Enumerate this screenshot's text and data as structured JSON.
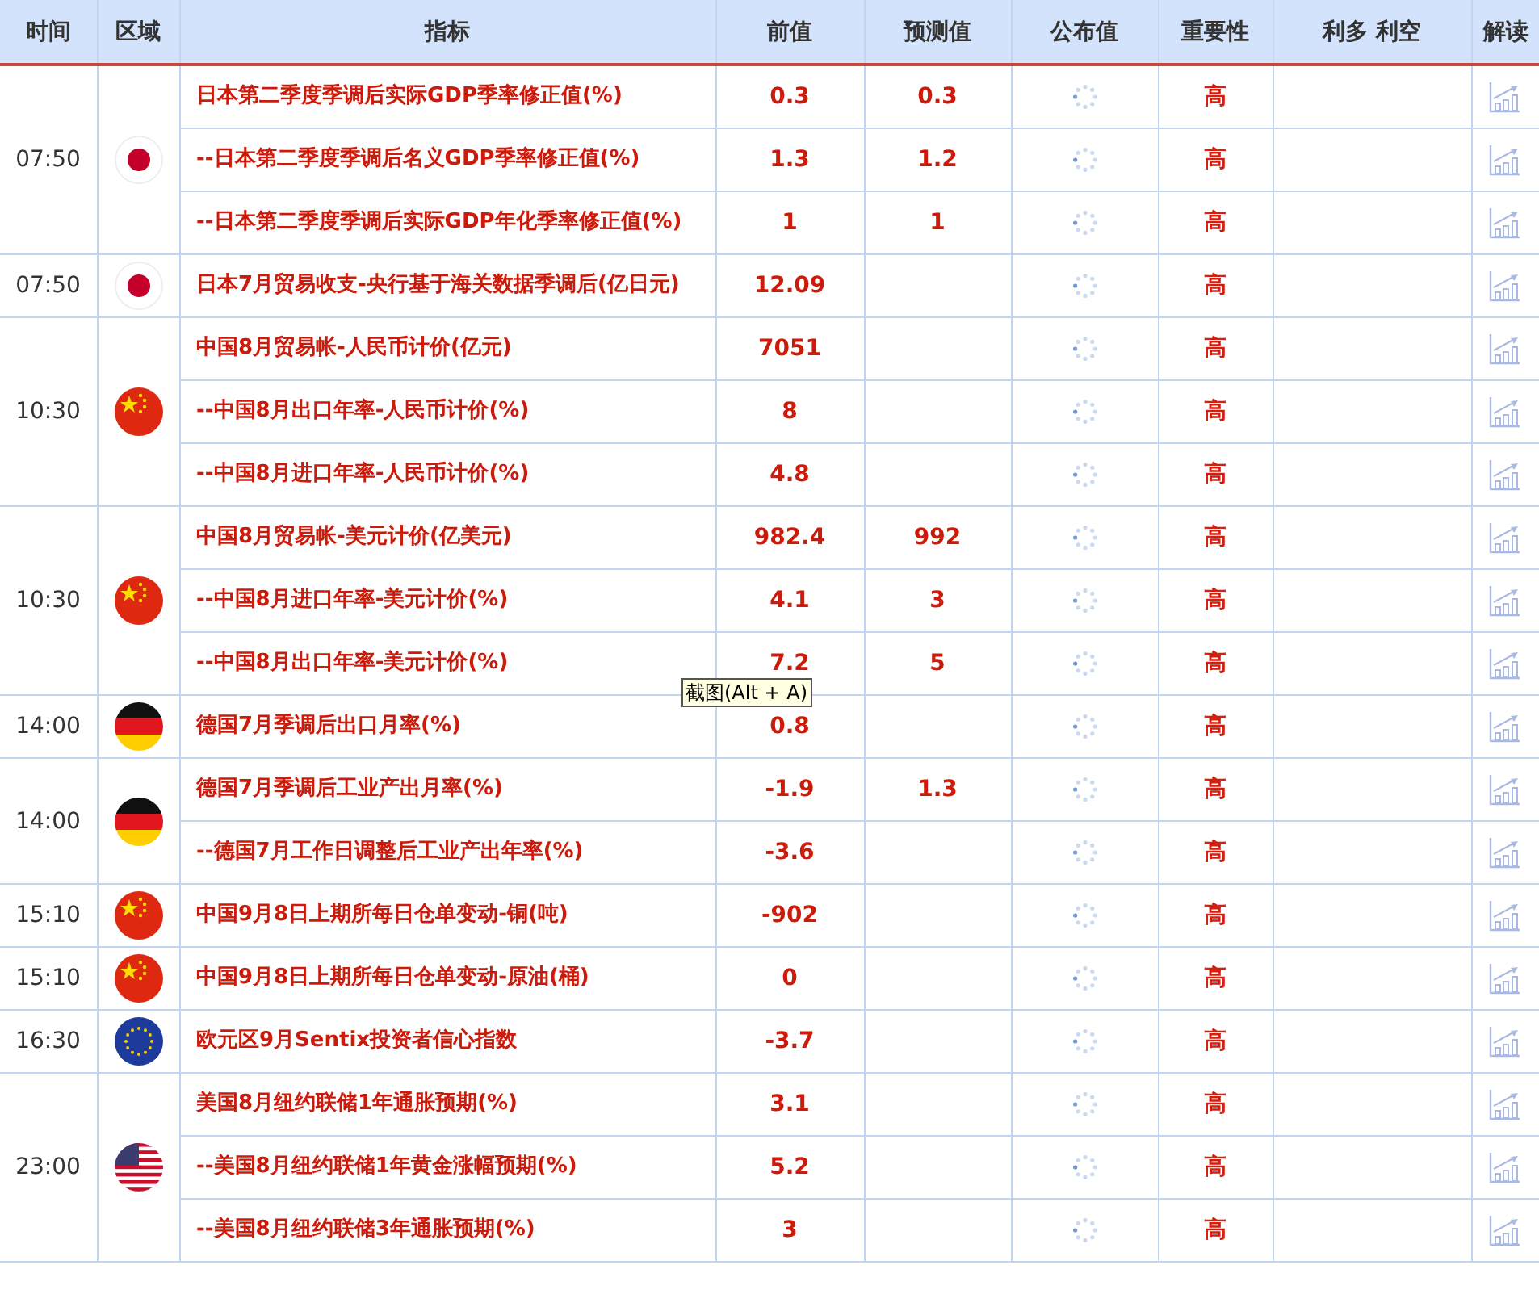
{
  "table": {
    "columns": [
      "时间",
      "区域",
      "指标",
      "前值",
      "预测值",
      "公布值",
      "重要性",
      "利多 利空",
      "解读"
    ],
    "groups": [
      {
        "time": "07:50",
        "kind": "jp",
        "rows": [
          {
            "indicator": "日本第二季度季调后实际GDP季率修正值(%)",
            "previous": "0.3",
            "forecast": "0.3",
            "importance": "高"
          },
          {
            "indicator": "--日本第二季度季调后名义GDP季率修正值(%)",
            "previous": "1.3",
            "forecast": "1.2",
            "importance": "高"
          },
          {
            "indicator": "--日本第二季度季调后实际GDP年化季率修正值(%)",
            "previous": "1",
            "forecast": "1",
            "importance": "高"
          }
        ]
      },
      {
        "time": "07:50",
        "kind": "jp",
        "rows": [
          {
            "indicator": "日本7月贸易收支-央行基于海关数据季调后(亿日元)",
            "previous": "12.09",
            "importance": "高"
          }
        ]
      },
      {
        "time": "10:30",
        "kind": "cn",
        "rows": [
          {
            "indicator": "中国8月贸易帐-人民币计价(亿元)",
            "previous": "7051",
            "importance": "高"
          },
          {
            "indicator": "--中国8月出口年率-人民币计价(%)",
            "previous": "8",
            "importance": "高"
          },
          {
            "indicator": "--中国8月进口年率-人民币计价(%)",
            "previous": "4.8",
            "importance": "高"
          }
        ]
      },
      {
        "time": "10:30",
        "kind": "cn",
        "rows": [
          {
            "indicator": "中国8月贸易帐-美元计价(亿美元)",
            "previous": "982.4",
            "forecast": "992",
            "importance": "高"
          },
          {
            "indicator": "--中国8月进口年率-美元计价(%)",
            "previous": "4.1",
            "forecast": "3",
            "importance": "高"
          },
          {
            "indicator": "--中国8月出口年率-美元计价(%)",
            "previous": "7.2",
            "forecast": "5",
            "importance": "高",
            "tooltip": "截图(Alt + A)"
          }
        ]
      },
      {
        "time": "14:00",
        "kind": "de",
        "rows": [
          {
            "indicator": "德国7月季调后出口月率(%)",
            "previous": "0.8",
            "importance": "高"
          }
        ]
      },
      {
        "time": "14:00",
        "kind": "de",
        "rows": [
          {
            "indicator": "德国7月季调后工业产出月率(%)",
            "previous": "-1.9",
            "forecast": "1.3",
            "importance": "高"
          },
          {
            "indicator": "--德国7月工作日调整后工业产出年率(%)",
            "previous": "-3.6",
            "importance": "高"
          }
        ]
      },
      {
        "time": "15:10",
        "kind": "cn",
        "rows": [
          {
            "indicator": "中国9月8日上期所每日仓单变动-铜(吨)",
            "previous": "-902",
            "importance": "高"
          }
        ]
      },
      {
        "time": "15:10",
        "kind": "cn",
        "rows": [
          {
            "indicator": "中国9月8日上期所每日仓单变动-原油(桶)",
            "previous": "0",
            "importance": "高"
          }
        ]
      },
      {
        "time": "16:30",
        "kind": "eu",
        "rows": [
          {
            "indicator": "欧元区9月Sentix投资者信心指数",
            "previous": "-3.7",
            "importance": "高"
          }
        ]
      },
      {
        "time": "23:00",
        "kind": "us",
        "rows": [
          {
            "indicator": "美国8月纽约联储1年通胀预期(%)",
            "previous": "3.1",
            "importance": "高"
          },
          {
            "indicator": "--美国8月纽约联储1年黄金涨幅预期(%)",
            "previous": "5.2",
            "importance": "高"
          },
          {
            "indicator": "--美国8月纽约联储3年通胀预期(%)",
            "previous": "3",
            "importance": "高"
          }
        ]
      }
    ]
  }
}
